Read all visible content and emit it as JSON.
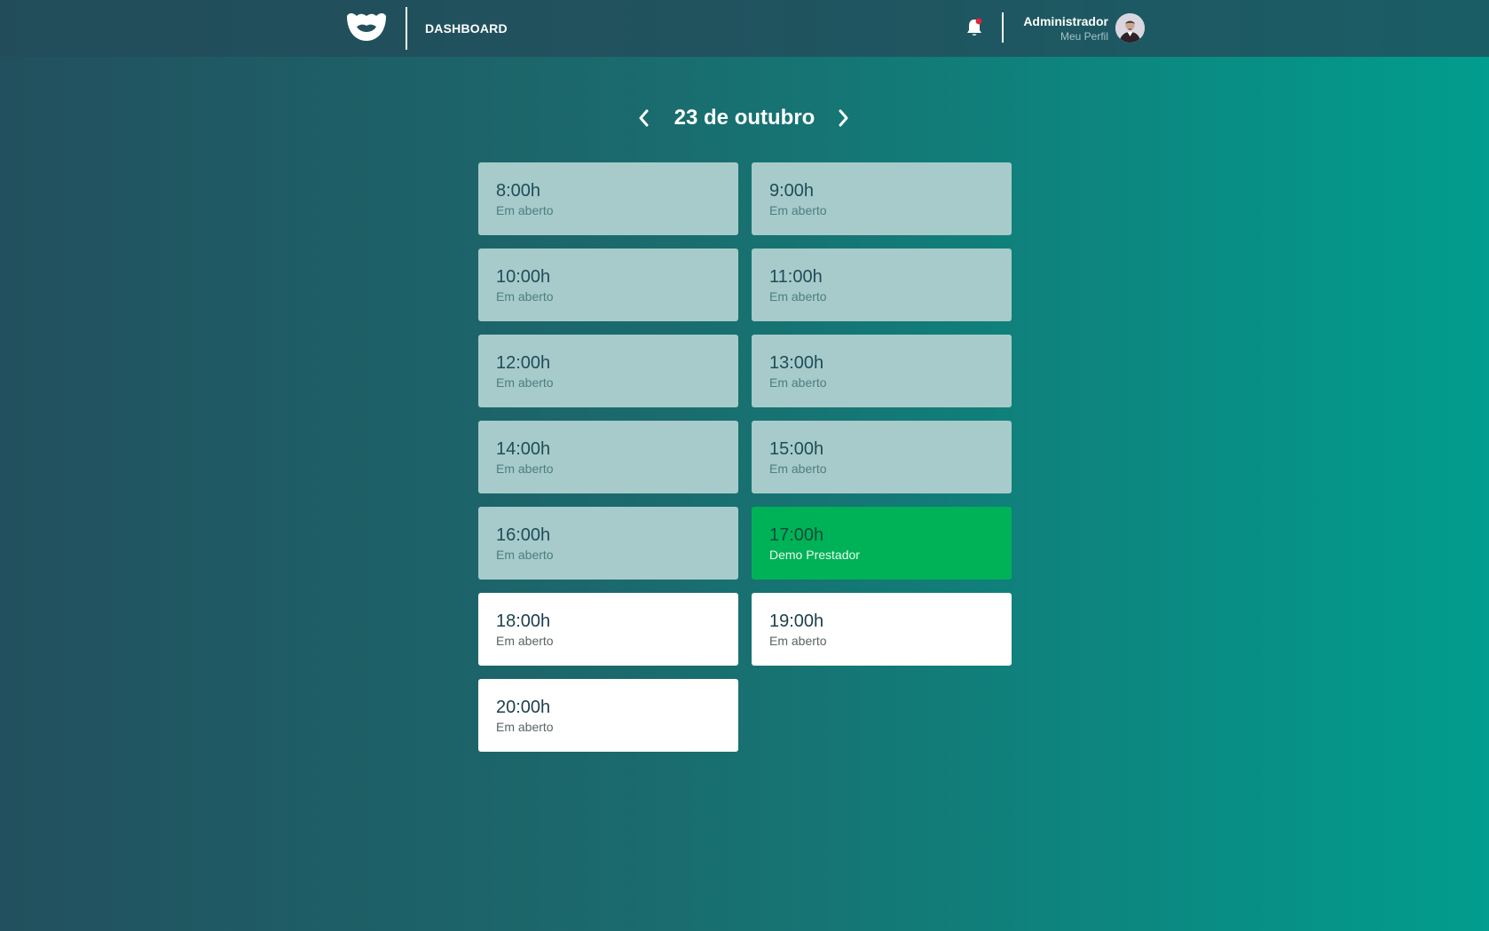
{
  "header": {
    "logo_icon": "mustache-logo-icon",
    "nav_label": "DASHBOARD",
    "notification_icon": "bell-icon",
    "notification_dot_color": "#e8203a",
    "user_name": "Administrador",
    "profile_link": "Meu Perfil",
    "avatar": "user-avatar"
  },
  "schedule": {
    "date_label": "23 de outubro",
    "prev_icon": "chevron-left-icon",
    "next_icon": "chevron-right-icon",
    "slots": [
      {
        "time": "8:00h",
        "status": "Em aberto",
        "state": "past"
      },
      {
        "time": "9:00h",
        "status": "Em aberto",
        "state": "past"
      },
      {
        "time": "10:00h",
        "status": "Em aberto",
        "state": "past"
      },
      {
        "time": "11:00h",
        "status": "Em aberto",
        "state": "past"
      },
      {
        "time": "12:00h",
        "status": "Em aberto",
        "state": "past"
      },
      {
        "time": "13:00h",
        "status": "Em aberto",
        "state": "past"
      },
      {
        "time": "14:00h",
        "status": "Em aberto",
        "state": "past"
      },
      {
        "time": "15:00h",
        "status": "Em aberto",
        "state": "past"
      },
      {
        "time": "16:00h",
        "status": "Em aberto",
        "state": "past"
      },
      {
        "time": "17:00h",
        "status": "Demo Prestador",
        "state": "booked"
      },
      {
        "time": "18:00h",
        "status": "Em aberto",
        "state": "open"
      },
      {
        "time": "19:00h",
        "status": "Em aberto",
        "state": "open"
      },
      {
        "time": "20:00h",
        "status": "Em aberto",
        "state": "open"
      }
    ]
  },
  "colors": {
    "past_slot": "#a7cbca",
    "booked_slot": "#00b257",
    "open_slot": "#ffffff"
  }
}
